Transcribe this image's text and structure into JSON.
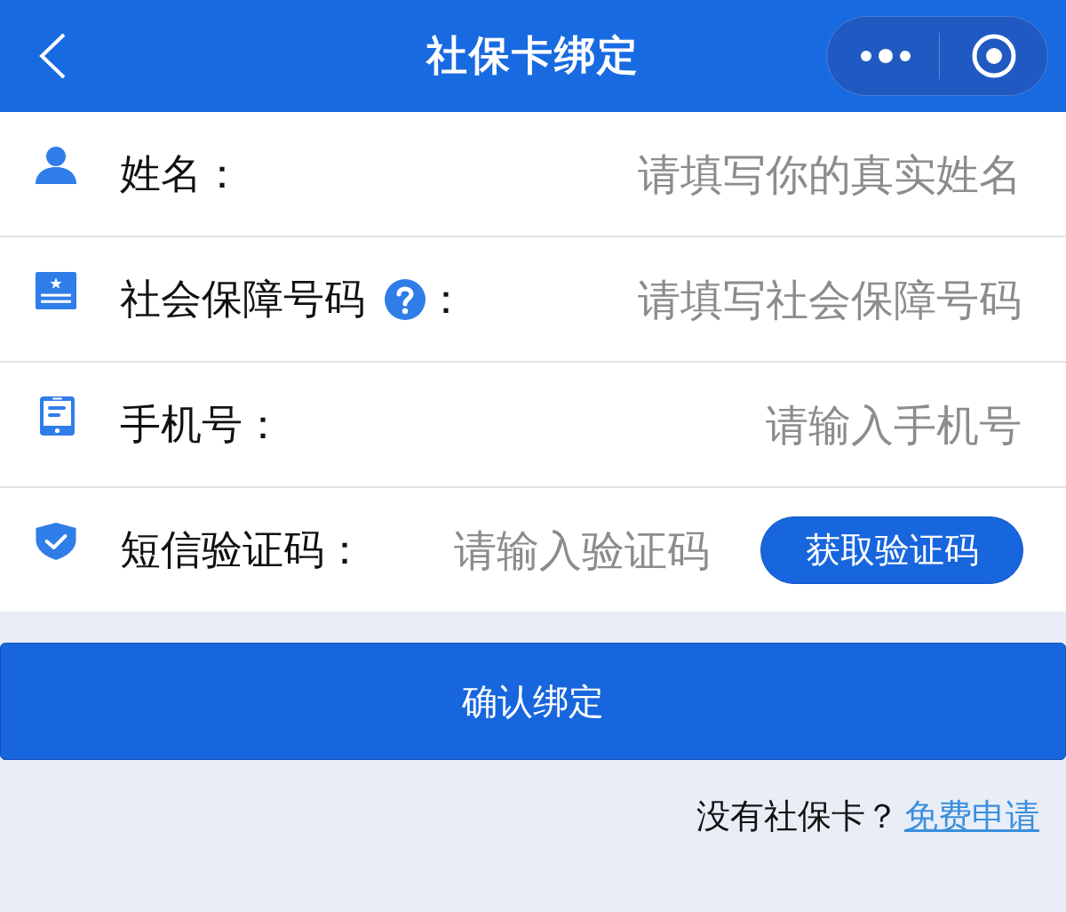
{
  "header": {
    "title": "社保卡绑定"
  },
  "fields": [
    {
      "kind": "plain",
      "label": "姓名",
      "help": false,
      "colon": "：",
      "placeholder": "请填写你的真实姓名"
    },
    {
      "kind": "plain",
      "label": "社会保障号码",
      "help": true,
      "colon": "：",
      "placeholder": "请填写社会保障号码"
    },
    {
      "kind": "plain",
      "label": "手机号",
      "help": false,
      "colon": "：",
      "placeholder": "请输入手机号"
    },
    {
      "kind": "code",
      "label": "短信验证码",
      "help": false,
      "colon": "：",
      "placeholder": "请输入验证码",
      "button": "获取验证码"
    }
  ],
  "confirm_button": "确认绑定",
  "footer": {
    "prompt": "没有社保卡？",
    "link": "免费申请"
  }
}
